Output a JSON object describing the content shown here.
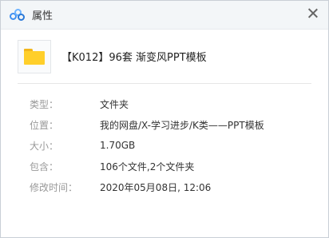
{
  "window": {
    "title": "属性"
  },
  "file": {
    "name": "【K012】96套 渐变风PPT模板"
  },
  "properties": [
    {
      "label": "类型：",
      "value": "文件夹"
    },
    {
      "label": "位置：",
      "value": "我的网盘/X-学习进步/K类——PPT模板"
    },
    {
      "label": "大小：",
      "value": "1.70GB"
    },
    {
      "label": "包含：",
      "value": "106个文件,2个文件夹"
    },
    {
      "label": "修改时间：",
      "value": "2020年05月08日, 12:06"
    }
  ],
  "icons": {
    "app": "baidu-netdisk-logo-icon",
    "close": "close-icon",
    "file": "folder-icon"
  }
}
